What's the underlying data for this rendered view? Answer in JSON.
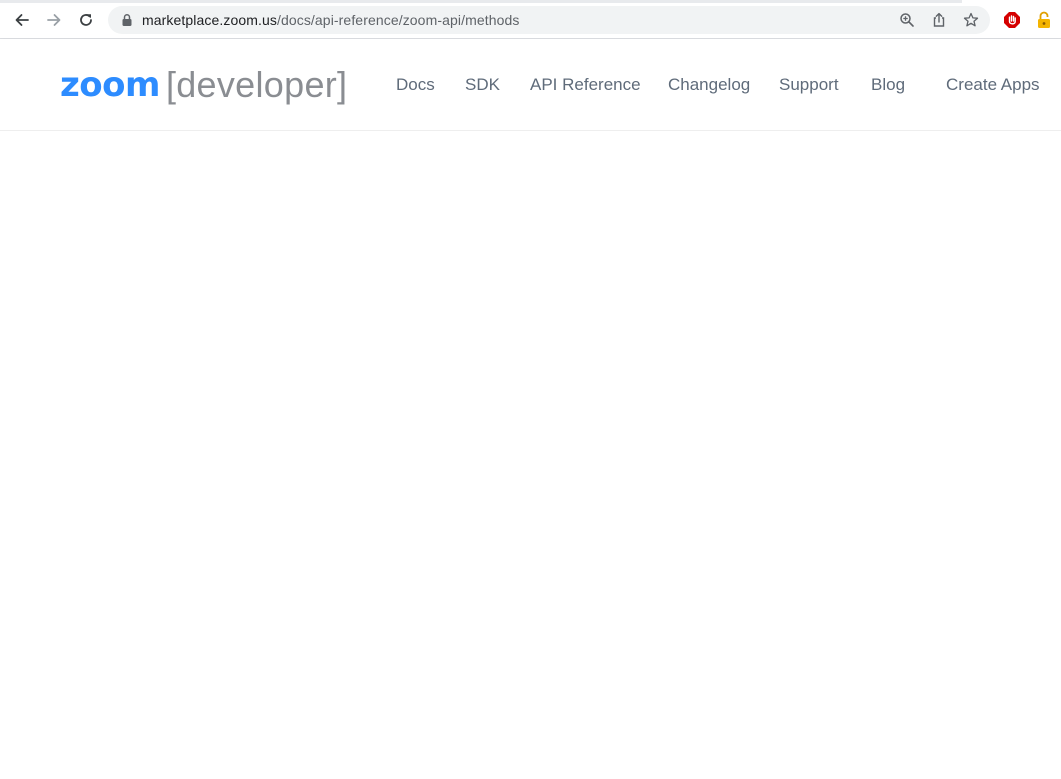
{
  "browser": {
    "url_host": "marketplace.zoom.us",
    "url_path": "/docs/api-reference/zoom-api/methods",
    "icons": {
      "back": "back-arrow-icon",
      "forward": "forward-arrow-icon",
      "reload": "reload-icon",
      "lock": "lock-icon",
      "zoom": "zoom-magnifier-icon",
      "share": "share-icon",
      "bookmark": "star-icon",
      "extension_1": "adblock-icon",
      "extension_2": "padlock-extension-icon"
    }
  },
  "header": {
    "logo_brand": "zoom",
    "logo_suffix": "[developer]",
    "nav": {
      "docs": "Docs",
      "sdk": "SDK",
      "api_reference": "API Reference",
      "changelog": "Changelog",
      "support": "Support",
      "blog": "Blog",
      "create_apps": "Create Apps"
    }
  },
  "colors": {
    "brand_blue": "#2d8cff",
    "logo_gray": "#8a8d92",
    "nav_text": "#5f6b7a"
  }
}
